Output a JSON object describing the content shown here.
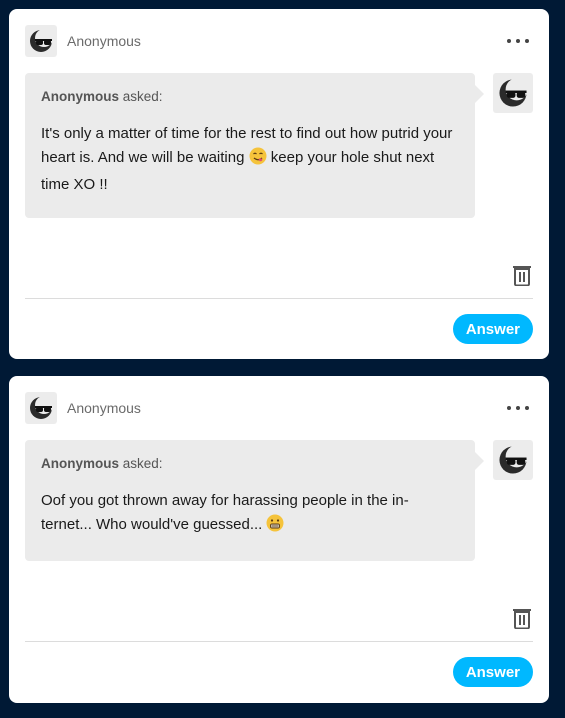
{
  "posts": [
    {
      "blog_name": "Anonymous",
      "asker": "Anonymous",
      "asked_label": "asked:",
      "question_part1": "It's only a matter of time for the rest to find out how putrid your heart is. And we will be waiting ",
      "question_part2": " keep your hole shut next time XO !!",
      "emoji_icon": "yum-face-emoji",
      "answer_label": "Answer"
    },
    {
      "blog_name": "Anonymous",
      "asker": "Anonymous",
      "asked_label": "asked:",
      "question_part1": "Oof you got thrown away for harassing people in the in-ternet... Who would've guessed... ",
      "question_part2": "",
      "emoji_icon": "grimacing-face-emoji",
      "answer_label": "Answer"
    }
  ],
  "colors": {
    "background": "#001935",
    "card": "#ffffff",
    "bubble": "#ebebeb",
    "accent": "#00b8ff"
  },
  "icons": {
    "avatar": "anonymous-sunglasses-icon",
    "more": "more-options-icon",
    "trash": "trash-icon"
  }
}
